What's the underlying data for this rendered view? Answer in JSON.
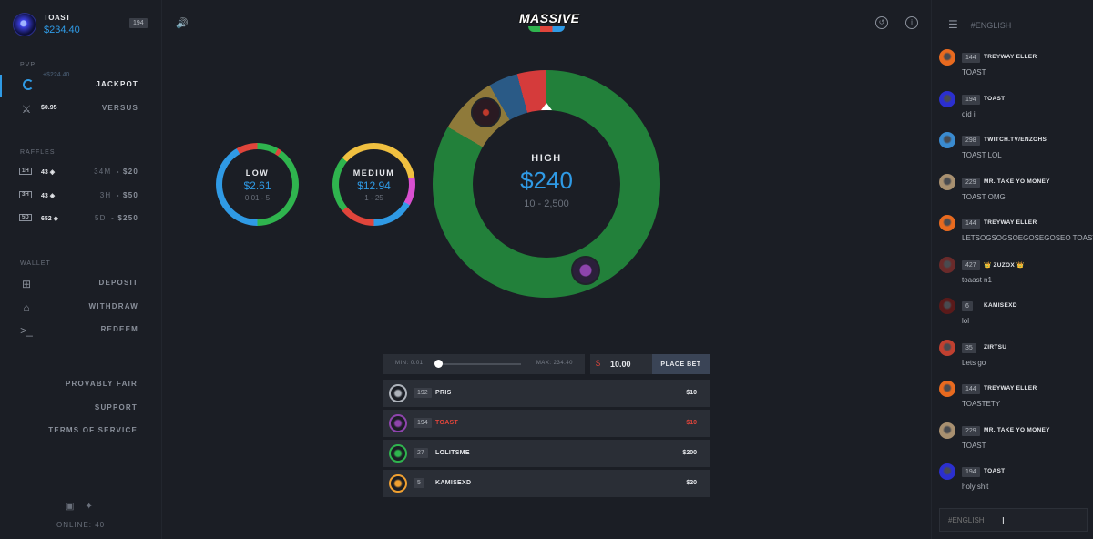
{
  "user": {
    "name": "TOAST",
    "balance": "$234.40",
    "level": "194"
  },
  "sidebar": {
    "pvp_title": "PVP",
    "ghost_value": "+$224.40",
    "jackpot_label": "JACKPOT",
    "versus_value": "$0.95",
    "versus_label": "VERSUS",
    "raffles_title": "RAFFLES",
    "raffles": [
      {
        "tag": "1H",
        "count": "43",
        "time": "34M",
        "prize": "$20"
      },
      {
        "tag": "3H",
        "count": "43",
        "time": "3H",
        "prize": "$50"
      },
      {
        "tag": "5D",
        "count": "652",
        "time": "5D",
        "prize": "$250"
      }
    ],
    "wallet_title": "WALLET",
    "deposit": "DEPOSIT",
    "withdraw": "WITHDRAW",
    "redeem": "REDEEM",
    "provably_fair": "PROVABLY FAIR",
    "support": "SUPPORT",
    "terms": "TERMS OF SERVICE",
    "online": "ONLINE: 40"
  },
  "logo": {
    "text": "MASSIVE",
    "sub": "GG"
  },
  "wheels": {
    "low": {
      "name": "LOW",
      "amount": "$2.61",
      "range": "0.01 - 5"
    },
    "medium": {
      "name": "MEDIUM",
      "amount": "$12.94",
      "range": "1 - 25"
    },
    "high": {
      "name": "HIGH",
      "amount": "$240",
      "range": "10 - 2,500"
    }
  },
  "bet": {
    "min": "MIN: 0.01",
    "max": "MAX: 234.40",
    "currency": "$",
    "value": "10.00",
    "slider_fraction": 0.0,
    "place": "PLACE BET"
  },
  "bets": [
    {
      "level": "192",
      "name": "PRIS",
      "amount": "$10",
      "me": false,
      "color": "#aeb3bb"
    },
    {
      "level": "194",
      "name": "TOAST",
      "amount": "$10",
      "me": true,
      "color": "#8e44ad"
    },
    {
      "level": "27",
      "name": "LOLITSME",
      "amount": "$200",
      "me": false,
      "color": "#2fb44e"
    },
    {
      "level": "5",
      "name": "KAMISEXD",
      "amount": "$20",
      "me": false,
      "color": "#f0a030"
    }
  ],
  "chat": {
    "channel": "#ENGLISH",
    "placeholder": "#ENGLISH",
    "messages": [
      {
        "level": "144",
        "name": "TREYWAY ELLER",
        "text": "TOAST",
        "avatar": "#e86a1f"
      },
      {
        "level": "194",
        "name": "TOAST",
        "text": "did i",
        "avatar": "#2b2fcf"
      },
      {
        "level": "298",
        "name": "TWITCH.TV/ENZOHS",
        "text": "TOAST LOL",
        "avatar": "#3a8bd0"
      },
      {
        "level": "229",
        "name": "MR. TAKE YO MONEY",
        "text": "TOAST OMG",
        "avatar": "#a89070"
      },
      {
        "level": "144",
        "name": "TREYWAY ELLER",
        "text": "LETSOGSOGSOEGOSEGOSEO TOAST",
        "avatar": "#e86a1f"
      },
      {
        "level": "427",
        "name": "ZUZOX",
        "text": "toaast n1",
        "avatar": "#6a2a2a",
        "crown": "👑"
      },
      {
        "level": "6",
        "name": "KAMISEXD",
        "text": "lol",
        "avatar": "#5a1a1a"
      },
      {
        "level": "35",
        "name": "ZIRTSU",
        "text": "Lets go",
        "avatar": "#c04030"
      },
      {
        "level": "144",
        "name": "TREYWAY ELLER",
        "text": "TOASTETY",
        "avatar": "#e86a1f"
      },
      {
        "level": "229",
        "name": "MR. TAKE YO MONEY",
        "text": "TOAST",
        "avatar": "#a89070"
      },
      {
        "level": "194",
        "name": "TOAST",
        "text": "holy shit",
        "avatar": "#2b2fcf"
      }
    ]
  }
}
